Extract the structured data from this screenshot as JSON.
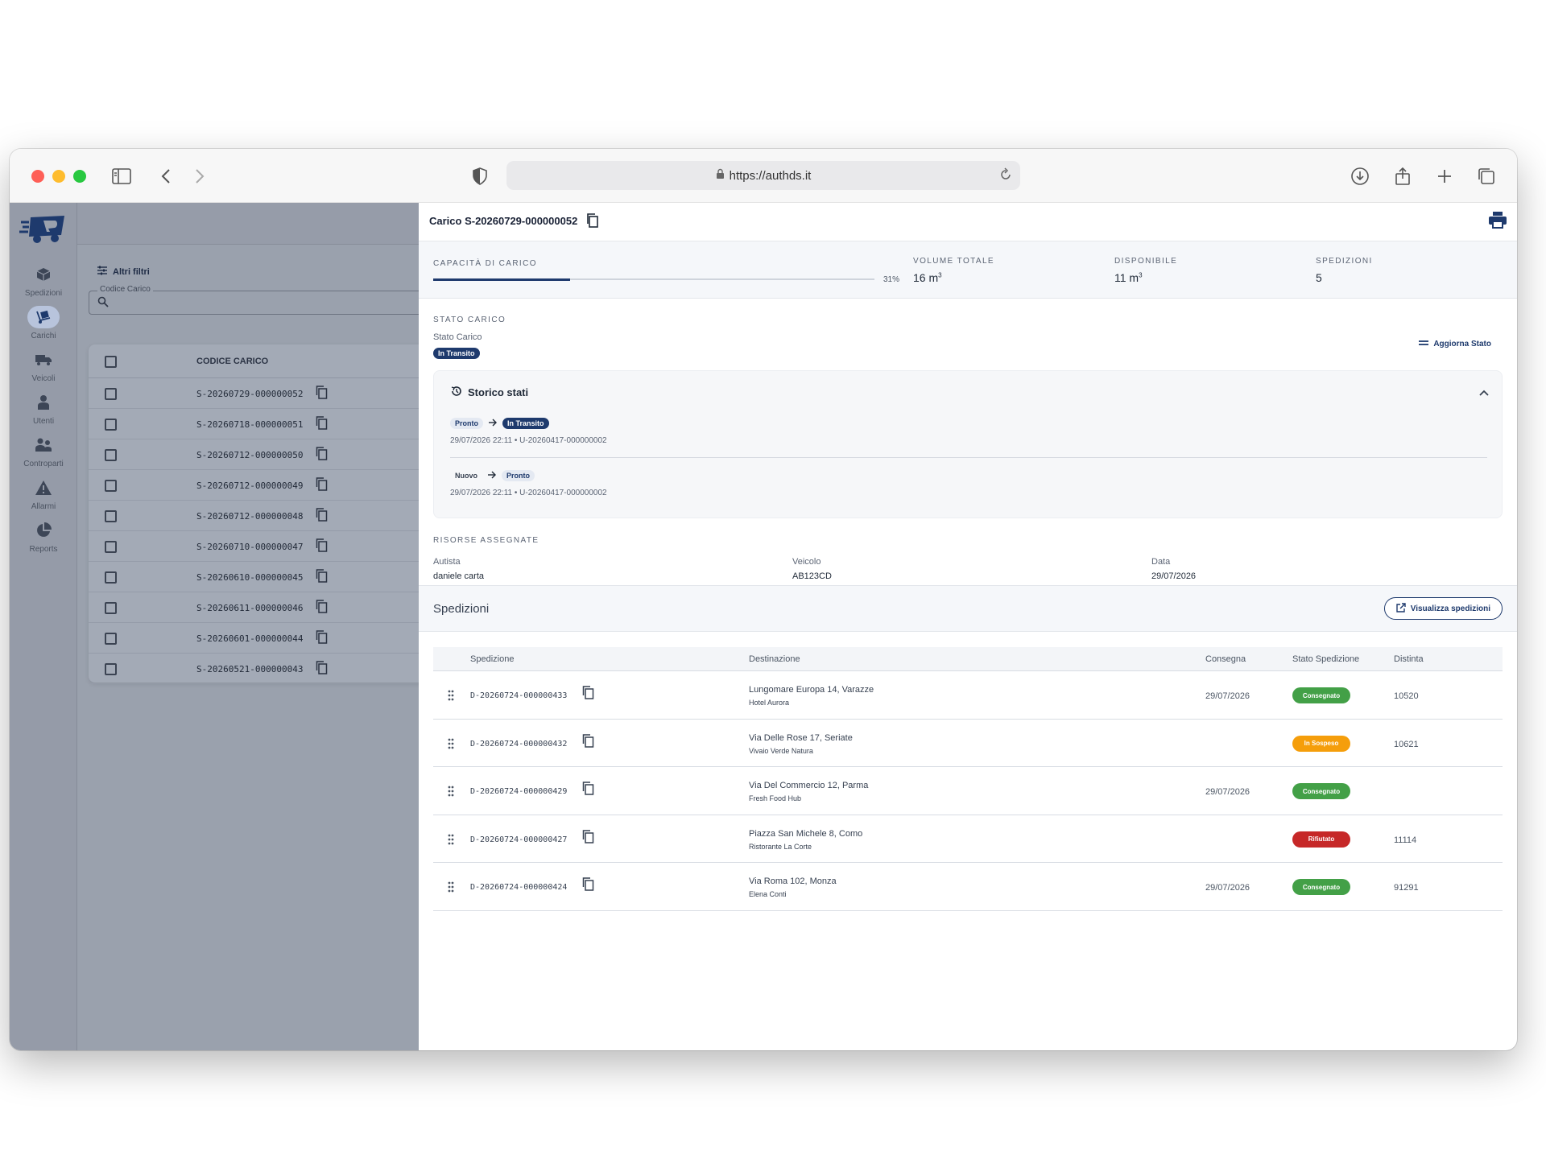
{
  "browser": {
    "url": "https://authds.it"
  },
  "sidenav": {
    "items": [
      {
        "label": "Spedizioni",
        "icon": "box-icon"
      },
      {
        "label": "Carichi",
        "icon": "dolly-icon",
        "active": true
      },
      {
        "label": "Veicoli",
        "icon": "truck-icon"
      },
      {
        "label": "Utenti",
        "icon": "user-icon"
      },
      {
        "label": "Controparti",
        "icon": "users-icon"
      },
      {
        "label": "Allarmi",
        "icon": "warning-icon"
      },
      {
        "label": "Reports",
        "icon": "pie-chart-icon"
      }
    ]
  },
  "list": {
    "filters_label": "Altri filtri",
    "search_label": "Codice Carico",
    "column_header": "CODICE CARICO",
    "rows": [
      "S-20260729-000000052",
      "S-20260718-000000051",
      "S-20260712-000000050",
      "S-20260712-000000049",
      "S-20260712-000000048",
      "S-20260710-000000047",
      "S-20260610-000000045",
      "S-20260611-000000046",
      "S-20260601-000000044",
      "S-20260521-000000043"
    ]
  },
  "detail": {
    "title": "Carico S-20260729-000000052",
    "capacity": {
      "label": "CAPACITÀ DI CARICO",
      "percent": 31,
      "percent_text": "31%"
    },
    "kpis": [
      {
        "label": "VOLUME TOTALE",
        "value": "16 m",
        "unit_sup": "3"
      },
      {
        "label": "DISPONIBILE",
        "value": "11 m",
        "unit_sup": "3"
      },
      {
        "label": "SPEDIZIONI",
        "value": "5",
        "unit_sup": ""
      }
    ],
    "stato": {
      "section_label": "STATO CARICO",
      "field_label": "Stato Carico",
      "value": "In Transito",
      "update_button": "Aggiorna Stato"
    },
    "history": {
      "title": "Storico stati",
      "entries": [
        {
          "from": "Pronto",
          "to": "In Transito",
          "meta": "29/07/2026 22:11 • U-20260417-000000002"
        },
        {
          "from": "Nuovo",
          "to": "Pronto",
          "meta": "29/07/2026 22:11 • U-20260417-000000002"
        }
      ]
    },
    "resources": {
      "section_label": "RISORSE ASSEGNATE",
      "fields": [
        {
          "label": "Autista",
          "value": "daniele carta"
        },
        {
          "label": "Veicolo",
          "value": "AB123CD"
        },
        {
          "label": "Data",
          "value": "29/07/2026"
        }
      ]
    },
    "shipments": {
      "title": "Spedizioni",
      "view_button": "Visualizza spedizioni",
      "columns": [
        "Spedizione",
        "Destinazione",
        "Consegna",
        "Stato Spedizione",
        "Distinta"
      ],
      "rows": [
        {
          "code": "D-20260724-000000433",
          "address": "Lungomare Europa 14, Varazze",
          "recipient": "Hotel Aurora",
          "delivery": "29/07/2026",
          "status": "Consegnato",
          "status_color": "#43a047",
          "distinta": "10520"
        },
        {
          "code": "D-20260724-000000432",
          "address": "Via Delle Rose 17, Seriate",
          "recipient": "Vivaio Verde Natura",
          "delivery": "",
          "status": "In Sospeso",
          "status_color": "#f59e0b",
          "distinta": "10621"
        },
        {
          "code": "D-20260724-000000429",
          "address": "Via Del Commercio 12, Parma",
          "recipient": "Fresh Food Hub",
          "delivery": "29/07/2026",
          "status": "Consegnato",
          "status_color": "#43a047",
          "distinta": ""
        },
        {
          "code": "D-20260724-000000427",
          "address": "Piazza San Michele 8, Como",
          "recipient": "Ristorante La Corte",
          "delivery": "",
          "status": "Rifiutato",
          "status_color": "#c62828",
          "distinta": "11114"
        },
        {
          "code": "D-20260724-000000424",
          "address": "Via Roma 102, Monza",
          "recipient": "Elena Conti",
          "delivery": "29/07/2026",
          "status": "Consegnato",
          "status_color": "#43a047",
          "distinta": "91291"
        }
      ]
    }
  },
  "colors": {
    "brand": "#1e3a6d"
  }
}
